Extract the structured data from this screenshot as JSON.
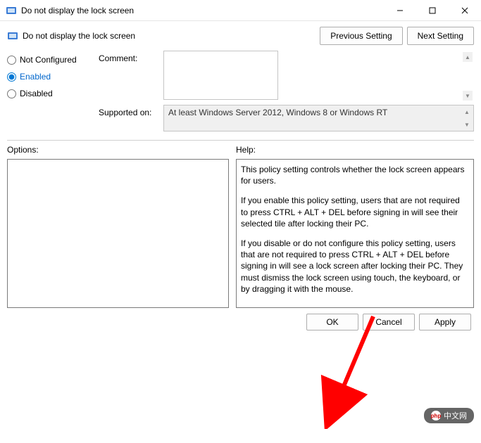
{
  "titlebar": {
    "title": "Do not display the lock screen"
  },
  "header": {
    "title": "Do not display the lock screen",
    "previous_setting": "Previous Setting",
    "next_setting": "Next Setting"
  },
  "radio": {
    "not_configured": "Not Configured",
    "enabled": "Enabled",
    "disabled": "Disabled",
    "selected": "enabled"
  },
  "fields": {
    "comment_label": "Comment:",
    "comment_value": "",
    "supported_label": "Supported on:",
    "supported_value": "At least Windows Server 2012, Windows 8 or Windows RT"
  },
  "sections": {
    "options_label": "Options:",
    "help_label": "Help:"
  },
  "help": {
    "p1": "This policy setting controls whether the lock screen appears for users.",
    "p2": "If you enable this policy setting, users that are not required to press CTRL + ALT + DEL before signing in will see their selected tile after locking their PC.",
    "p3": "If you disable or do not configure this policy setting, users that are not required to press CTRL + ALT + DEL before signing in will see a lock screen after locking their PC. They must dismiss the lock screen using touch, the keyboard, or by dragging it with the mouse."
  },
  "footer": {
    "ok": "OK",
    "cancel": "Cancel",
    "apply": "Apply"
  },
  "watermark": {
    "text": "中文网"
  }
}
